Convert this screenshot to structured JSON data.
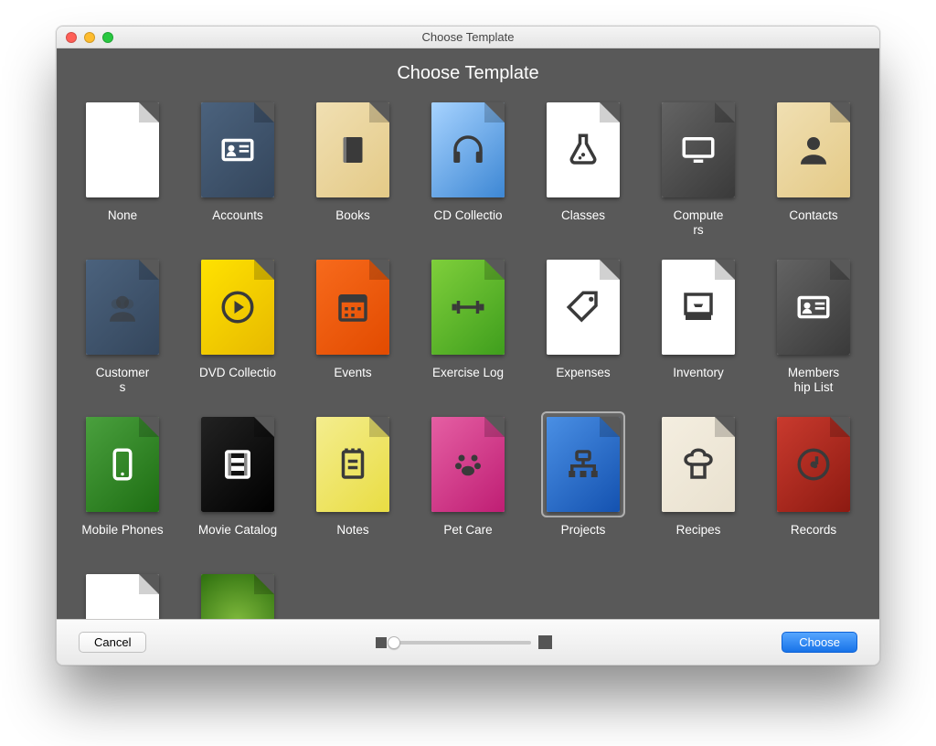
{
  "window": {
    "title": "Choose Template"
  },
  "heading": "Choose Template",
  "footer": {
    "cancel_label": "Cancel",
    "choose_label": "Choose"
  },
  "selected_template": "Projects",
  "templates": [
    {
      "label": "None",
      "bg": "bg-white",
      "icon": "",
      "light": false
    },
    {
      "label": "Accounts",
      "bg": "bg-slate",
      "icon": "id-card",
      "light": true
    },
    {
      "label": "Books",
      "bg": "bg-tan",
      "icon": "book",
      "light": false
    },
    {
      "label": "CD Collectio",
      "bg": "bg-sky",
      "icon": "headphones",
      "light": false
    },
    {
      "label": "Classes",
      "bg": "bg-white",
      "icon": "flask",
      "light": false
    },
    {
      "label": "Compute\nrs",
      "bg": "bg-grey",
      "icon": "monitor",
      "light": true
    },
    {
      "label": "Contacts",
      "bg": "bg-tan",
      "icon": "person",
      "light": false
    },
    {
      "label": "Customer\ns",
      "bg": "bg-slate",
      "icon": "silhouette",
      "light": false
    },
    {
      "label": "DVD Collectio",
      "bg": "bg-yellow",
      "icon": "play-disc",
      "light": false
    },
    {
      "label": "Events",
      "bg": "bg-orange",
      "icon": "calendar",
      "light": false
    },
    {
      "label": "Exercise Log",
      "bg": "bg-green",
      "icon": "dumbbell",
      "light": false
    },
    {
      "label": "Expenses",
      "bg": "bg-white",
      "icon": "tag",
      "light": false
    },
    {
      "label": "Inventory",
      "bg": "bg-white",
      "icon": "inbox",
      "light": false
    },
    {
      "label": "Members\nhip List",
      "bg": "bg-grey",
      "icon": "id-card",
      "light": true
    },
    {
      "label": "Mobile Phones",
      "bg": "bg-greenD",
      "icon": "phone",
      "light": true
    },
    {
      "label": "Movie Catalog",
      "bg": "bg-black",
      "icon": "film",
      "light": true
    },
    {
      "label": "Notes",
      "bg": "bg-lemon",
      "icon": "notepad",
      "light": false
    },
    {
      "label": "Pet Care",
      "bg": "bg-pink",
      "icon": "paw",
      "light": false
    },
    {
      "label": "Projects",
      "bg": "bg-blueD",
      "icon": "orgchart",
      "light": false
    },
    {
      "label": "Recipes",
      "bg": "bg-cream",
      "icon": "chef",
      "light": false
    },
    {
      "label": "Records",
      "bg": "bg-red",
      "icon": "disc-note",
      "light": false
    },
    {
      "label": "",
      "bg": "bg-white",
      "icon": "",
      "light": false
    },
    {
      "label": "",
      "bg": "bg-garden",
      "icon": "",
      "light": false
    }
  ]
}
